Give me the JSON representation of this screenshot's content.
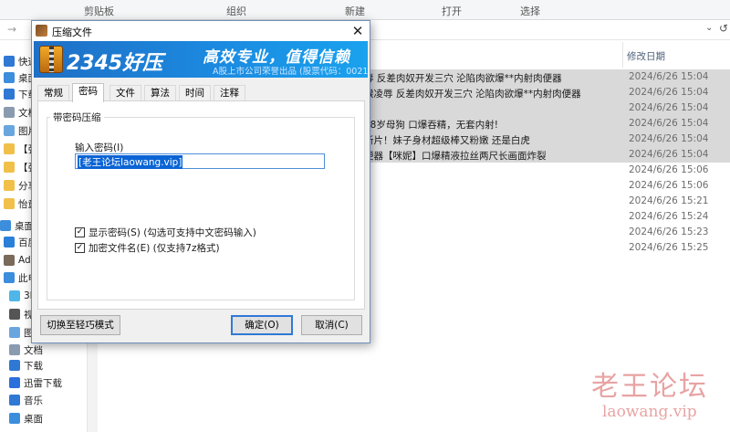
{
  "ribbon": {
    "groups": [
      "剪贴板",
      "组织",
      "新建",
      "打开",
      "选择"
    ]
  },
  "address": {
    "back": "→",
    "dropdown": "⌄",
    "refresh": "↺"
  },
  "sidebar": {
    "items": [
      {
        "label": "快速访",
        "color": "#2f78d4"
      },
      {
        "label": "桌面",
        "color": "#3c8ddc"
      },
      {
        "label": "下载",
        "color": "#2f78d4"
      },
      {
        "label": "文档",
        "color": "#8a9bb0"
      },
      {
        "label": "图片",
        "color": "#6aa6de"
      },
      {
        "label": "【张",
        "color": "#f0c04a"
      },
      {
        "label": "【张",
        "color": "#f0c04a"
      },
      {
        "label": "分享",
        "color": "#f0c04a"
      },
      {
        "label": "怡童",
        "color": "#f0c04a"
      },
      {
        "label": "桌面",
        "color": "#3c8ddc"
      },
      {
        "label": "百度",
        "color": "#2a7fd8"
      },
      {
        "label": "Adm",
        "color": "#7a6a5a"
      },
      {
        "label": "此电",
        "color": "#3c8ddc"
      },
      {
        "label": "3D",
        "color": "#4fb6e8"
      },
      {
        "label": "视",
        "color": "#555"
      },
      {
        "label": "图",
        "color": "#6aa6de"
      },
      {
        "label": "文档",
        "color": "#8a9bb0"
      },
      {
        "label": "下载",
        "color": "#2f78d4"
      },
      {
        "label": "迅雷下载",
        "color": "#2a6fdc"
      },
      {
        "label": "音乐",
        "color": "#2f78d4"
      },
      {
        "label": "桌面",
        "color": "#3c8ddc"
      }
    ]
  },
  "filelist": {
    "date_header": "修改日期",
    "rows": [
      {
        "name": "辱 反差肉奴开发三穴 沦陷肉欲爆**内射肉便器",
        "date": "2024/6/26 15:04",
        "selected": true
      },
      {
        "name": "喉凌辱 反差肉奴开发三穴 沦陷肉欲爆**内射肉便器",
        "date": "2024/6/26 15:04",
        "selected": true
      },
      {
        "name": "",
        "date": "2024/6/26 15:04",
        "selected": true
      },
      {
        "name": "18岁母狗 口爆吞精，无套内射!",
        "date": "2024/6/26 15:04",
        "selected": true
      },
      {
        "name": "新片！妹子身材超级棒又粉嫩 还是白虎",
        "date": "2024/6/26 15:04",
        "selected": true
      },
      {
        "name": "便器【咪妮】口爆精液拉丝两尺长画面炸裂",
        "date": "2024/6/26 15:04",
        "selected": true
      },
      {
        "name": "",
        "date": "2024/6/26 15:06",
        "selected": false
      },
      {
        "name": "",
        "date": "2024/6/26 15:06",
        "selected": false
      },
      {
        "name": "",
        "date": "2024/6/26 15:21",
        "selected": false
      },
      {
        "name": "",
        "date": "2024/6/26 15:24",
        "selected": false
      },
      {
        "name": "",
        "date": "2024/6/26 15:23",
        "selected": false
      },
      {
        "name": "",
        "date": "2024/6/26 15:25",
        "selected": false
      }
    ]
  },
  "watermark": {
    "line1": "老王论坛",
    "line2": "laowang.vip"
  },
  "dialog": {
    "title": "压缩文件",
    "close": "✕",
    "banner": {
      "brand": "2345好压",
      "slogan": "高效专业，值得信赖",
      "sub": "A股上市公司荣誉出品 (股票代码：002195)"
    },
    "tabs": [
      "常规",
      "密码",
      "文件",
      "算法",
      "时间",
      "注释"
    ],
    "active_tab": "密码",
    "group_label": "带密码压缩",
    "password_label": "输入密码(I)",
    "password_value": "[老王论坛laowang.vip]",
    "show_password": {
      "label": "显示密码(S)  (勾选可支持中文密码输入)",
      "checked": true
    },
    "encrypt_names": {
      "label": "加密文件名(E)  (仅支持7z格式)",
      "checked": true
    },
    "buttons": {
      "switch": "切换至轻巧模式",
      "ok": "确定(O)",
      "cancel": "取消(C)"
    }
  }
}
